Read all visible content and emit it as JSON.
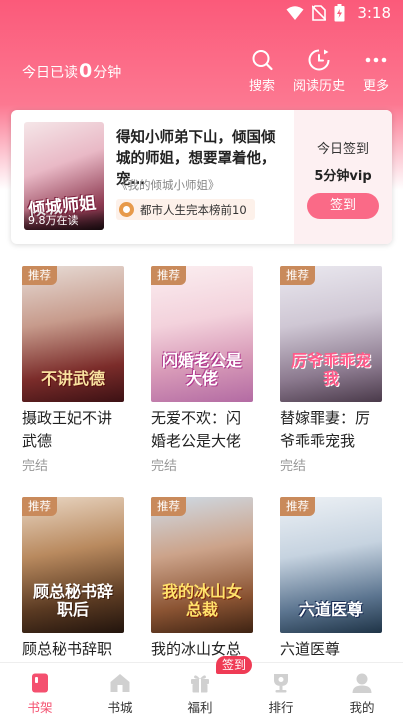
{
  "status_bar": {
    "time": "3:18"
  },
  "header": {
    "read_prefix": "今日已读",
    "read_minutes": "0",
    "read_suffix": "分钟",
    "actions": [
      {
        "label": "搜索",
        "icon": "search-icon"
      },
      {
        "label": "阅读历史",
        "icon": "history-icon"
      },
      {
        "label": "更多",
        "icon": "more-icon"
      }
    ]
  },
  "featured": {
    "cover_title": "倾城师姐",
    "cover_readers": "9.8万在读",
    "description": "得知小师弟下山，倾国倾城的师姐，想要罩着他，宠…",
    "book_name": "《我的倾城小师姐》",
    "rank": "都市人生完本榜前10",
    "checkin_label": "今日签到",
    "checkin_reward": "5分钟vip",
    "checkin_button": "签到"
  },
  "books": [
    {
      "tag": "推荐",
      "cover_art": "不讲武德",
      "title": "摄政王妃不讲武德",
      "status": "完结"
    },
    {
      "tag": "推荐",
      "cover_art": "闪婚老公是大佬",
      "title": "无爱不欢：闪婚老公是大佬",
      "status": "完结"
    },
    {
      "tag": "推荐",
      "cover_art": "厉爷乖乖宠我",
      "title": "替嫁罪妻：厉爷乖乖宠我",
      "status": "完结"
    },
    {
      "tag": "推荐",
      "cover_art": "顾总秘书辞职后",
      "title": "顾总秘书辞职",
      "status": ""
    },
    {
      "tag": "推荐",
      "cover_art": "我的冰山女总裁",
      "title": "我的冰山女总",
      "status": ""
    },
    {
      "tag": "推荐",
      "cover_art": "六道医尊",
      "title": "六道医尊",
      "status": ""
    }
  ],
  "tabs": [
    {
      "label": "书架",
      "icon": "bookshelf-icon",
      "active": true
    },
    {
      "label": "书城",
      "icon": "bookstore-icon",
      "active": false
    },
    {
      "label": "福利",
      "icon": "gift-icon",
      "active": false
    },
    {
      "label": "排行",
      "icon": "trophy-icon",
      "active": false
    },
    {
      "label": "我的",
      "icon": "profile-icon",
      "active": false
    }
  ],
  "tab_badge": "签到",
  "colors": {
    "accent": "#fa6a87",
    "active_tab": "#f4506f",
    "tag": "#c98a5b"
  }
}
